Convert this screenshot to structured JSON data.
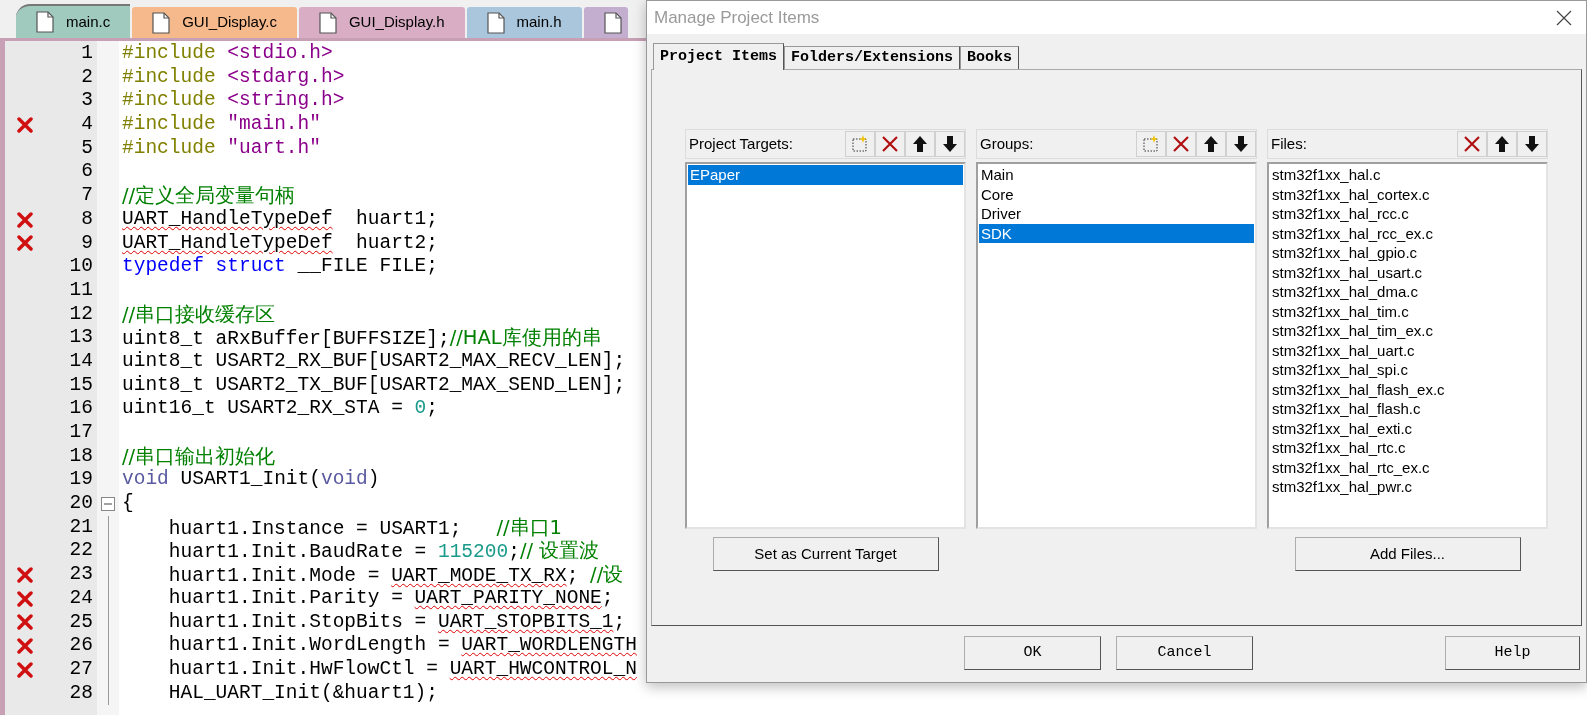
{
  "editor_tabs": [
    {
      "label": "main.c",
      "color": "#9fcabd",
      "selected": true
    },
    {
      "label": "GUI_Display.c",
      "color": "#f6b98b",
      "selected": false
    },
    {
      "label": "GUI_Display.h",
      "color": "#d9aec5",
      "selected": false
    },
    {
      "label": "main.h",
      "color": "#a9c6dc",
      "selected": false
    },
    {
      "color": "#c3aed0",
      "selected": false
    }
  ],
  "code_lines": [
    {
      "number": "1",
      "marked": false,
      "collapse_box": false,
      "fold_line": false,
      "segments": [
        {
          "kind": "directive",
          "text": "#include "
        },
        {
          "kind": "string",
          "text": "<stdio.h>"
        }
      ]
    },
    {
      "number": "2",
      "marked": false,
      "collapse_box": false,
      "fold_line": false,
      "segments": [
        {
          "kind": "directive",
          "text": "#include "
        },
        {
          "kind": "string",
          "text": "<stdarg.h>"
        }
      ]
    },
    {
      "number": "3",
      "marked": false,
      "collapse_box": false,
      "fold_line": false,
      "segments": [
        {
          "kind": "directive",
          "text": "#include "
        },
        {
          "kind": "string",
          "text": "<string.h>"
        }
      ]
    },
    {
      "number": "4",
      "marked": true,
      "collapse_box": false,
      "fold_line": false,
      "segments": [
        {
          "kind": "directive",
          "text": "#include "
        },
        {
          "kind": "string",
          "text": "\"main.h\""
        }
      ]
    },
    {
      "number": "5",
      "marked": false,
      "collapse_box": false,
      "fold_line": false,
      "segments": [
        {
          "kind": "directive",
          "text": "#include "
        },
        {
          "kind": "string",
          "text": "\"uart.h\""
        }
      ]
    },
    {
      "number": "6",
      "marked": false,
      "collapse_box": false,
      "fold_line": false
    },
    {
      "number": "7",
      "marked": false,
      "collapse_box": false,
      "fold_line": false,
      "segments": [
        {
          "kind": "comment",
          "text": "//定义全局变量句柄"
        }
      ]
    },
    {
      "number": "8",
      "marked": true,
      "collapse_box": false,
      "fold_line": false,
      "segments": [
        {
          "kind": "error",
          "text": "UART_HandleTypeDef"
        },
        {
          "kind": "text",
          "text": "  huart1;"
        }
      ]
    },
    {
      "number": "9",
      "marked": true,
      "collapse_box": false,
      "fold_line": false,
      "segments": [
        {
          "kind": "error",
          "text": "UART_HandleTypeDef"
        },
        {
          "kind": "text",
          "text": "  huart2;"
        }
      ]
    },
    {
      "number": "10",
      "marked": false,
      "collapse_box": false,
      "fold_line": false,
      "segments": [
        {
          "kind": "keyword",
          "text": "typedef struct"
        },
        {
          "kind": "text",
          "text": " __FILE FILE;"
        }
      ]
    },
    {
      "number": "11",
      "marked": false,
      "collapse_box": false,
      "fold_line": false
    },
    {
      "number": "12",
      "marked": false,
      "collapse_box": false,
      "fold_line": false,
      "segments": [
        {
          "kind": "comment",
          "text": "//串口接收缓存区"
        }
      ]
    },
    {
      "number": "13",
      "marked": false,
      "collapse_box": false,
      "fold_line": false,
      "segments": [
        {
          "kind": "text",
          "text": "uint8_t aRxBuffer[BUFFSIZE];"
        },
        {
          "kind": "comment",
          "text": "//HAL库使用的串"
        }
      ]
    },
    {
      "number": "14",
      "marked": false,
      "collapse_box": false,
      "fold_line": false,
      "segments": [
        {
          "kind": "text",
          "text": "uint8_t USART2_RX_BUF[USART2_MAX_RECV_LEN];"
        }
      ]
    },
    {
      "number": "15",
      "marked": false,
      "collapse_box": false,
      "fold_line": false,
      "segments": [
        {
          "kind": "text",
          "text": "uint8_t USART2_TX_BUF[USART2_MAX_SEND_LEN];"
        }
      ]
    },
    {
      "number": "16",
      "marked": false,
      "collapse_box": false,
      "fold_line": false,
      "segments": [
        {
          "kind": "text",
          "text": "uint16_t USART2_RX_STA = "
        },
        {
          "kind": "number",
          "text": "0"
        },
        {
          "kind": "text",
          "text": ";"
        }
      ]
    },
    {
      "number": "17",
      "marked": false,
      "collapse_box": false,
      "fold_line": false
    },
    {
      "number": "18",
      "marked": false,
      "collapse_box": false,
      "fold_line": false,
      "segments": [
        {
          "kind": "comment",
          "text": "//串口输出初始化"
        }
      ]
    },
    {
      "number": "19",
      "marked": false,
      "collapse_box": false,
      "fold_line": false,
      "segments": [
        {
          "kind": "type",
          "text": "void"
        },
        {
          "kind": "text",
          "text": " USART1_Init("
        },
        {
          "kind": "type",
          "text": "void"
        },
        {
          "kind": "text",
          "text": ")"
        }
      ]
    },
    {
      "number": "20",
      "marked": false,
      "collapse_box": true,
      "fold_line": false,
      "segments": [
        {
          "kind": "text",
          "text": "{"
        }
      ]
    },
    {
      "number": "21",
      "marked": false,
      "collapse_box": false,
      "fold_line": true,
      "segments": [
        {
          "kind": "text",
          "text": "    huart1.Instance = USART1;   "
        },
        {
          "kind": "comment",
          "text": "//串口1"
        }
      ]
    },
    {
      "number": "22",
      "marked": false,
      "collapse_box": false,
      "fold_line": true,
      "segments": [
        {
          "kind": "text",
          "text": "    huart1.Init.BaudRate = "
        },
        {
          "kind": "number",
          "text": "115200"
        },
        {
          "kind": "text",
          "text": ";"
        },
        {
          "kind": "comment",
          "text": "// 设置波"
        }
      ]
    },
    {
      "number": "23",
      "marked": true,
      "collapse_box": false,
      "fold_line": true,
      "segments": [
        {
          "kind": "text",
          "text": "    huart1.Init.Mode = "
        },
        {
          "kind": "error",
          "text": "UART_MODE_TX_RX"
        },
        {
          "kind": "text",
          "text": "; "
        },
        {
          "kind": "comment",
          "text": "//设"
        }
      ]
    },
    {
      "number": "24",
      "marked": true,
      "collapse_box": false,
      "fold_line": true,
      "segments": [
        {
          "kind": "text",
          "text": "    huart1.Init.Parity = "
        },
        {
          "kind": "error",
          "text": "UART_PARITY_NONE"
        },
        {
          "kind": "text",
          "text": ";"
        }
      ]
    },
    {
      "number": "25",
      "marked": true,
      "collapse_box": false,
      "fold_line": true,
      "segments": [
        {
          "kind": "text",
          "text": "    huart1.Init.StopBits = "
        },
        {
          "kind": "error",
          "text": "UART_STOPBITS_1"
        },
        {
          "kind": "text",
          "text": ";"
        }
      ]
    },
    {
      "number": "26",
      "marked": true,
      "collapse_box": false,
      "fold_line": true,
      "segments": [
        {
          "kind": "text",
          "text": "    huart1.Init.WordLength = "
        },
        {
          "kind": "error",
          "text": "UART_WORDLENGTH"
        }
      ]
    },
    {
      "number": "27",
      "marked": true,
      "collapse_box": false,
      "fold_line": true,
      "segments": [
        {
          "kind": "text",
          "text": "    huart1.Init.HwFlowCtl = "
        },
        {
          "kind": "error",
          "text": "UART_HWCONTROL_N"
        }
      ]
    },
    {
      "number": "28",
      "marked": false,
      "collapse_box": false,
      "fold_line": true,
      "segments": [
        {
          "kind": "text",
          "text": "    HAL_UART_Init(&huart1);"
        }
      ]
    }
  ],
  "dialog": {
    "title": "Manage Project Items",
    "tabs": [
      {
        "label": "Project Items",
        "selected": true
      },
      {
        "label": "Folders/Extensions",
        "selected": false
      },
      {
        "label": "Books",
        "selected": false
      }
    ],
    "columns": [
      {
        "label": "Project Targets:",
        "tools": [
          {
            "kind": "new"
          },
          {
            "kind": "delete"
          },
          {
            "kind": "up"
          },
          {
            "kind": "down"
          }
        ],
        "items": [
          {
            "label": "EPaper",
            "selected": true
          }
        ],
        "button": "Set as Current Target"
      },
      {
        "label": "Groups:",
        "tools": [
          {
            "kind": "new"
          },
          {
            "kind": "delete"
          },
          {
            "kind": "up"
          },
          {
            "kind": "down"
          }
        ],
        "items": [
          {
            "label": "Main",
            "selected": false
          },
          {
            "label": "Core",
            "selected": false
          },
          {
            "label": "Driver",
            "selected": false
          },
          {
            "label": "SDK",
            "selected": true
          }
        ]
      },
      {
        "label": "Files:",
        "tools": [
          {
            "kind": "delete"
          },
          {
            "kind": "up"
          },
          {
            "kind": "down"
          }
        ],
        "items": [
          {
            "label": "stm32f1xx_hal.c",
            "selected": false
          },
          {
            "label": "stm32f1xx_hal_cortex.c",
            "selected": false
          },
          {
            "label": "stm32f1xx_hal_rcc.c",
            "selected": false
          },
          {
            "label": "stm32f1xx_hal_rcc_ex.c",
            "selected": false
          },
          {
            "label": "stm32f1xx_hal_gpio.c",
            "selected": false
          },
          {
            "label": "stm32f1xx_hal_usart.c",
            "selected": false
          },
          {
            "label": "stm32f1xx_hal_dma.c",
            "selected": false
          },
          {
            "label": "stm32f1xx_hal_tim.c",
            "selected": false
          },
          {
            "label": "stm32f1xx_hal_tim_ex.c",
            "selected": false
          },
          {
            "label": "stm32f1xx_hal_uart.c",
            "selected": false
          },
          {
            "label": "stm32f1xx_hal_spi.c",
            "selected": false
          },
          {
            "label": "stm32f1xx_hal_flash_ex.c",
            "selected": false
          },
          {
            "label": "stm32f1xx_hal_flash.c",
            "selected": false
          },
          {
            "label": "stm32f1xx_hal_exti.c",
            "selected": false
          },
          {
            "label": "stm32f1xx_hal_rtc.c",
            "selected": false
          },
          {
            "label": "stm32f1xx_hal_rtc_ex.c",
            "selected": false
          },
          {
            "label": "stm32f1xx_hal_pwr.c",
            "selected": false
          }
        ],
        "button": "Add Files..."
      }
    ],
    "footer_buttons": [
      "OK",
      "Cancel",
      "Help"
    ]
  }
}
